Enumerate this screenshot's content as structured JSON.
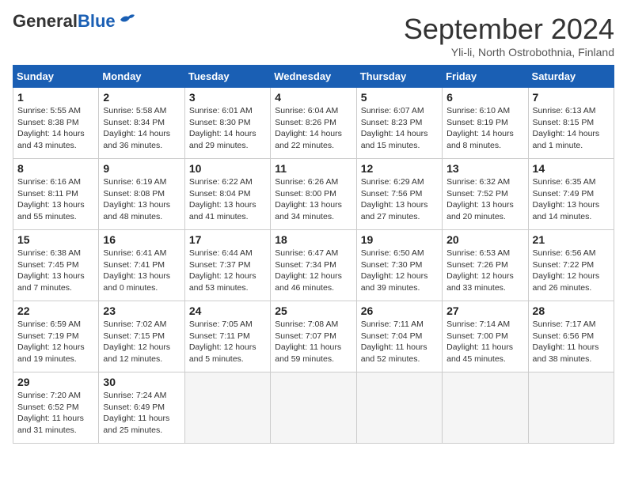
{
  "header": {
    "logo_line1": "General",
    "logo_line2": "Blue",
    "month_title": "September 2024",
    "subtitle": "Yli-li, North Ostrobothnia, Finland"
  },
  "columns": [
    "Sunday",
    "Monday",
    "Tuesday",
    "Wednesday",
    "Thursday",
    "Friday",
    "Saturday"
  ],
  "weeks": [
    [
      {
        "day": "1",
        "info": "Sunrise: 5:55 AM\nSunset: 8:38 PM\nDaylight: 14 hours\nand 43 minutes."
      },
      {
        "day": "2",
        "info": "Sunrise: 5:58 AM\nSunset: 8:34 PM\nDaylight: 14 hours\nand 36 minutes."
      },
      {
        "day": "3",
        "info": "Sunrise: 6:01 AM\nSunset: 8:30 PM\nDaylight: 14 hours\nand 29 minutes."
      },
      {
        "day": "4",
        "info": "Sunrise: 6:04 AM\nSunset: 8:26 PM\nDaylight: 14 hours\nand 22 minutes."
      },
      {
        "day": "5",
        "info": "Sunrise: 6:07 AM\nSunset: 8:23 PM\nDaylight: 14 hours\nand 15 minutes."
      },
      {
        "day": "6",
        "info": "Sunrise: 6:10 AM\nSunset: 8:19 PM\nDaylight: 14 hours\nand 8 minutes."
      },
      {
        "day": "7",
        "info": "Sunrise: 6:13 AM\nSunset: 8:15 PM\nDaylight: 14 hours\nand 1 minute."
      }
    ],
    [
      {
        "day": "8",
        "info": "Sunrise: 6:16 AM\nSunset: 8:11 PM\nDaylight: 13 hours\nand 55 minutes."
      },
      {
        "day": "9",
        "info": "Sunrise: 6:19 AM\nSunset: 8:08 PM\nDaylight: 13 hours\nand 48 minutes."
      },
      {
        "day": "10",
        "info": "Sunrise: 6:22 AM\nSunset: 8:04 PM\nDaylight: 13 hours\nand 41 minutes."
      },
      {
        "day": "11",
        "info": "Sunrise: 6:26 AM\nSunset: 8:00 PM\nDaylight: 13 hours\nand 34 minutes."
      },
      {
        "day": "12",
        "info": "Sunrise: 6:29 AM\nSunset: 7:56 PM\nDaylight: 13 hours\nand 27 minutes."
      },
      {
        "day": "13",
        "info": "Sunrise: 6:32 AM\nSunset: 7:52 PM\nDaylight: 13 hours\nand 20 minutes."
      },
      {
        "day": "14",
        "info": "Sunrise: 6:35 AM\nSunset: 7:49 PM\nDaylight: 13 hours\nand 14 minutes."
      }
    ],
    [
      {
        "day": "15",
        "info": "Sunrise: 6:38 AM\nSunset: 7:45 PM\nDaylight: 13 hours\nand 7 minutes."
      },
      {
        "day": "16",
        "info": "Sunrise: 6:41 AM\nSunset: 7:41 PM\nDaylight: 13 hours\nand 0 minutes."
      },
      {
        "day": "17",
        "info": "Sunrise: 6:44 AM\nSunset: 7:37 PM\nDaylight: 12 hours\nand 53 minutes."
      },
      {
        "day": "18",
        "info": "Sunrise: 6:47 AM\nSunset: 7:34 PM\nDaylight: 12 hours\nand 46 minutes."
      },
      {
        "day": "19",
        "info": "Sunrise: 6:50 AM\nSunset: 7:30 PM\nDaylight: 12 hours\nand 39 minutes."
      },
      {
        "day": "20",
        "info": "Sunrise: 6:53 AM\nSunset: 7:26 PM\nDaylight: 12 hours\nand 33 minutes."
      },
      {
        "day": "21",
        "info": "Sunrise: 6:56 AM\nSunset: 7:22 PM\nDaylight: 12 hours\nand 26 minutes."
      }
    ],
    [
      {
        "day": "22",
        "info": "Sunrise: 6:59 AM\nSunset: 7:19 PM\nDaylight: 12 hours\nand 19 minutes."
      },
      {
        "day": "23",
        "info": "Sunrise: 7:02 AM\nSunset: 7:15 PM\nDaylight: 12 hours\nand 12 minutes."
      },
      {
        "day": "24",
        "info": "Sunrise: 7:05 AM\nSunset: 7:11 PM\nDaylight: 12 hours\nand 5 minutes."
      },
      {
        "day": "25",
        "info": "Sunrise: 7:08 AM\nSunset: 7:07 PM\nDaylight: 11 hours\nand 59 minutes."
      },
      {
        "day": "26",
        "info": "Sunrise: 7:11 AM\nSunset: 7:04 PM\nDaylight: 11 hours\nand 52 minutes."
      },
      {
        "day": "27",
        "info": "Sunrise: 7:14 AM\nSunset: 7:00 PM\nDaylight: 11 hours\nand 45 minutes."
      },
      {
        "day": "28",
        "info": "Sunrise: 7:17 AM\nSunset: 6:56 PM\nDaylight: 11 hours\nand 38 minutes."
      }
    ],
    [
      {
        "day": "29",
        "info": "Sunrise: 7:20 AM\nSunset: 6:52 PM\nDaylight: 11 hours\nand 31 minutes."
      },
      {
        "day": "30",
        "info": "Sunrise: 7:24 AM\nSunset: 6:49 PM\nDaylight: 11 hours\nand 25 minutes."
      },
      {
        "day": "",
        "info": ""
      },
      {
        "day": "",
        "info": ""
      },
      {
        "day": "",
        "info": ""
      },
      {
        "day": "",
        "info": ""
      },
      {
        "day": "",
        "info": ""
      }
    ]
  ]
}
